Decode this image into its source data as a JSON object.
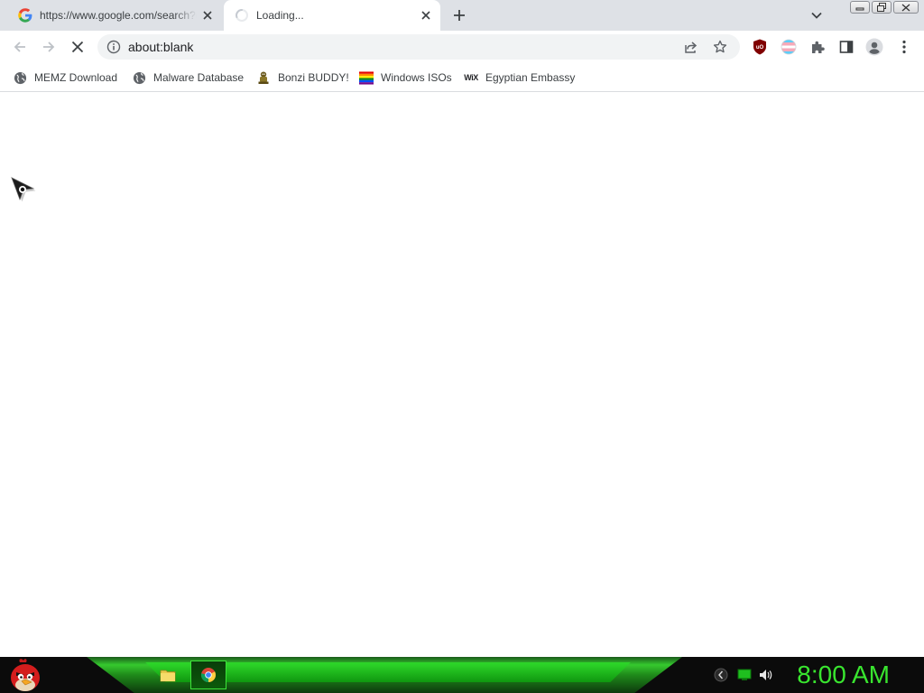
{
  "tabs": [
    {
      "title": "https://www.google.com/search?q=",
      "favicon": "google-icon",
      "active": false
    },
    {
      "title": "Loading...",
      "favicon": "loading-spinner-icon",
      "active": true
    }
  ],
  "toolbar": {
    "url": "about:blank"
  },
  "bookmarks": [
    {
      "label": "MEMZ Download",
      "icon": "globe-icon"
    },
    {
      "label": "Malware Database",
      "icon": "globe-icon"
    },
    {
      "label": "Bonzi BUDDY!",
      "icon": "bonzi-icon"
    },
    {
      "label": "Windows ISOs",
      "icon": "rainbow-flag-icon"
    },
    {
      "label": "Egyptian Embassy",
      "icon": "wix-icon"
    }
  ],
  "bookmark_icon_text": {
    "wix": "WiX"
  },
  "extensions": {
    "ublock_text": "uO"
  },
  "taskbar": {
    "clock": "8:00 AM"
  },
  "colors": {
    "tabstrip": "#dee1e6",
    "taskbar_green": "#39e52f",
    "ublock_red": "#800000"
  }
}
